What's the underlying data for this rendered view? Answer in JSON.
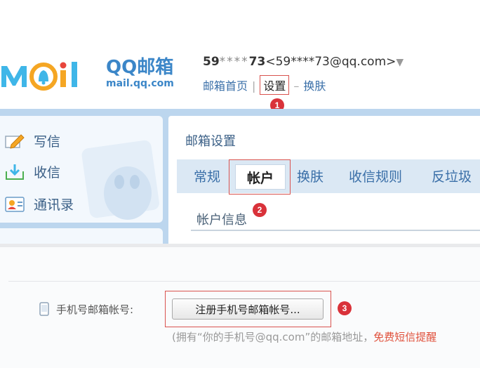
{
  "logo": {
    "brand_mark": "MOil",
    "qq_text": "QQ邮箱",
    "url_text": "mail.qq.com"
  },
  "header": {
    "user_prefix": "59",
    "user_mask": "****",
    "user_suffix": "73",
    "email_display": "<59****73@qq.com>",
    "dropdown_caret": "▼",
    "nav": {
      "home": "邮箱首页",
      "sep": "|",
      "settings": "设置",
      "dash": "–",
      "skin": "换肤"
    }
  },
  "sidebar": {
    "items": [
      {
        "label": "写信",
        "icon": "compose-icon"
      },
      {
        "label": "收信",
        "icon": "inbox-icon"
      },
      {
        "label": "通讯录",
        "icon": "contacts-icon"
      }
    ]
  },
  "settings": {
    "title": "邮箱设置",
    "tabs": [
      {
        "label": "常规",
        "active": false
      },
      {
        "label": "帐户",
        "active": true
      },
      {
        "label": "换肤",
        "active": false
      },
      {
        "label": "收信规则",
        "active": false
      },
      {
        "label": "反垃圾",
        "active": false
      }
    ],
    "section_title": "帐户信息"
  },
  "phone_account": {
    "label": "手机号邮箱帐号:",
    "register_button": "注册手机号邮箱帐号...",
    "hint_prefix": "(拥有“你的手机号@qq.com”的邮箱地址，",
    "hint_red": "免费短信提醒"
  },
  "badges": {
    "one": "1",
    "two": "2",
    "three": "3"
  },
  "colors": {
    "accent_blue": "#3b86c8",
    "link_blue": "#3a6fa8",
    "highlight_red": "#d9534f",
    "badge_red": "#d9323a",
    "band_blue": "#bcd6ee",
    "tab_bg": "#dbe8f4"
  }
}
